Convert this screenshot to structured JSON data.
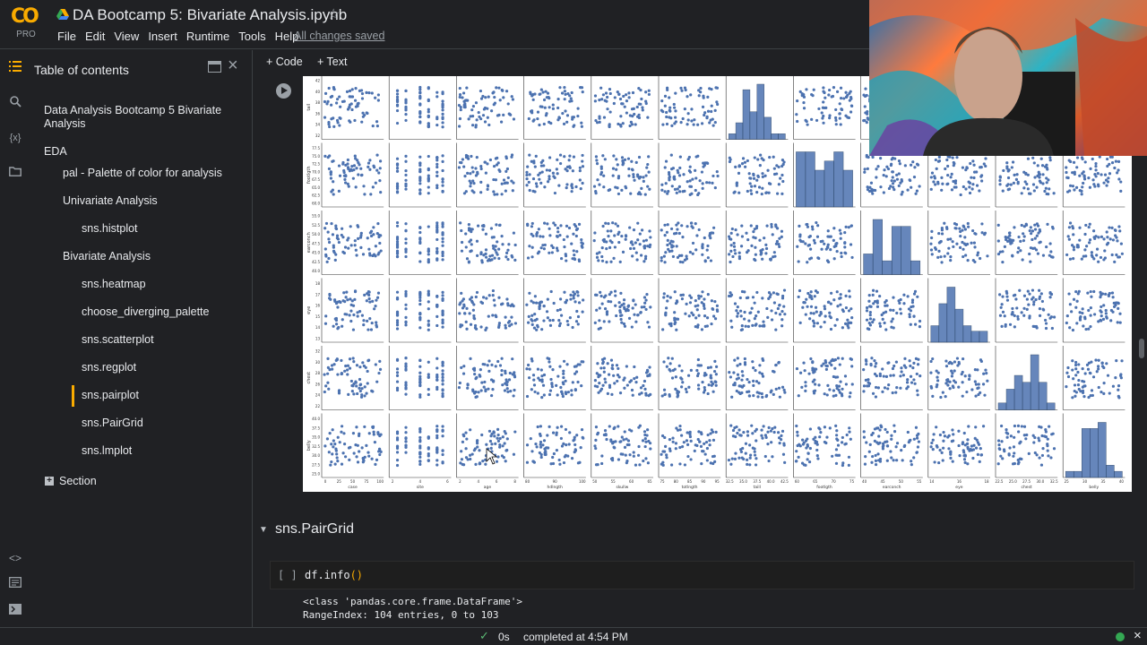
{
  "header": {
    "logo_text": "CO",
    "logo_sub": "PRO",
    "title": "DA Bootcamp 5: Bivariate Analysis.ipynb",
    "star_icon": "star-outline-icon",
    "menu": [
      "File",
      "Edit",
      "View",
      "Insert",
      "Runtime",
      "Tools",
      "Help"
    ],
    "save_status": "All changes saved"
  },
  "rail": {
    "icons": [
      "toc-icon",
      "search-icon",
      "variables-icon",
      "folder-icon",
      "code-snippets-icon",
      "command-palette-icon",
      "terminal-icon"
    ],
    "variables_label": "{x}"
  },
  "sidebar": {
    "title": "Table of contents",
    "items": [
      {
        "label": "Data Analysis Bootcamp 5 Bivariate Analysis",
        "level": 1
      },
      {
        "label": "EDA",
        "level": 1
      },
      {
        "label": "pal - Palette of color for analysis",
        "level": 2
      },
      {
        "label": "Univariate Analysis",
        "level": 2
      },
      {
        "label": "sns.histplot",
        "level": 3
      },
      {
        "label": "Bivariate Analysis",
        "level": 2
      },
      {
        "label": "sns.heatmap",
        "level": 3
      },
      {
        "label": "choose_diverging_palette",
        "level": 3
      },
      {
        "label": "sns.scatterplot",
        "level": 3
      },
      {
        "label": "sns.regplot",
        "level": 3
      },
      {
        "label": "sns.pairplot",
        "level": 3,
        "selected": true
      },
      {
        "label": "sns.PairGrid",
        "level": 3
      },
      {
        "label": "sns.lmplot",
        "level": 3
      },
      {
        "label": "Section",
        "level": 1
      }
    ],
    "toc_title_line2": "Analysis"
  },
  "toolbar": {
    "code_label": "+ Code",
    "text_label": "+ Text"
  },
  "plot": {
    "row_labels": [
      "tail",
      "footlgth",
      "earconch",
      "eye",
      "chest",
      "belly"
    ],
    "col_labels": [
      "case",
      "site",
      "age",
      "hdlngth",
      "skullw",
      "totlngth",
      "taill",
      "footlgth",
      "earconch",
      "eye",
      "chest",
      "belly"
    ],
    "point_color": "#4c72b0",
    "x_ticks": [
      [
        "0",
        "25",
        "50",
        "75",
        "100"
      ],
      [
        "2",
        "4",
        "6"
      ],
      [
        "2",
        "4",
        "6",
        "8"
      ],
      [
        "80",
        "90",
        "100"
      ],
      [
        "50",
        "55",
        "60",
        "65"
      ],
      [
        "75",
        "80",
        "85",
        "90",
        "95"
      ],
      [
        "32.5",
        "35.0",
        "37.5",
        "40.0",
        "42.5"
      ],
      [
        "60",
        "65",
        "70",
        "75"
      ],
      [
        "40",
        "45",
        "50",
        "55"
      ],
      [
        "14",
        "16",
        "18"
      ],
      [
        "22.5",
        "25.0",
        "27.5",
        "30.0",
        "32.5"
      ],
      [
        "25",
        "30",
        "35",
        "40"
      ]
    ],
    "y_ticks": [
      [
        "42",
        "40",
        "38",
        "36",
        "34",
        "32"
      ],
      [
        "77.5",
        "75.0",
        "72.5",
        "70.0",
        "67.5",
        "65.0",
        "62.5",
        "60.0"
      ],
      [
        "55.0",
        "52.5",
        "50.0",
        "47.5",
        "45.0",
        "42.5",
        "40.0"
      ],
      [
        "18",
        "17",
        "16",
        "15",
        "14",
        "13"
      ],
      [
        "32",
        "30",
        "28",
        "26",
        "24",
        "22"
      ],
      [
        "40.0",
        "37.5",
        "35.0",
        "32.5",
        "30.0",
        "27.5",
        "25.0"
      ]
    ],
    "diag_hist": [
      {
        "row": 0,
        "col": 6,
        "bars": [
          1,
          3,
          9,
          5,
          10,
          4,
          1,
          1
        ]
      },
      {
        "row": 1,
        "col": 7,
        "bars": [
          6,
          6,
          4,
          5,
          6,
          4
        ]
      },
      {
        "row": 2,
        "col": 8,
        "bars": [
          3,
          8,
          2,
          7,
          7,
          2
        ]
      },
      {
        "row": 3,
        "col": 9,
        "bars": [
          3,
          7,
          10,
          6,
          3,
          2,
          2
        ]
      },
      {
        "row": 4,
        "col": 10,
        "bars": [
          1,
          3,
          5,
          4,
          8,
          4,
          1
        ]
      },
      {
        "row": 5,
        "col": 11,
        "bars": [
          1,
          1,
          8,
          8,
          9,
          2,
          1
        ]
      }
    ]
  },
  "section": {
    "heading": "sns.PairGrid",
    "collapse_icon": "triangle-down-icon"
  },
  "code_cell": {
    "run_brackets": "[ ]",
    "code_name": "df.info",
    "code_parens": "()"
  },
  "output": [
    "<class 'pandas.core.frame.DataFrame'>",
    "RangeIndex: 104 entries, 0 to 103"
  ],
  "status": {
    "seconds": "0s",
    "completed": "completed at 4:54 PM"
  }
}
